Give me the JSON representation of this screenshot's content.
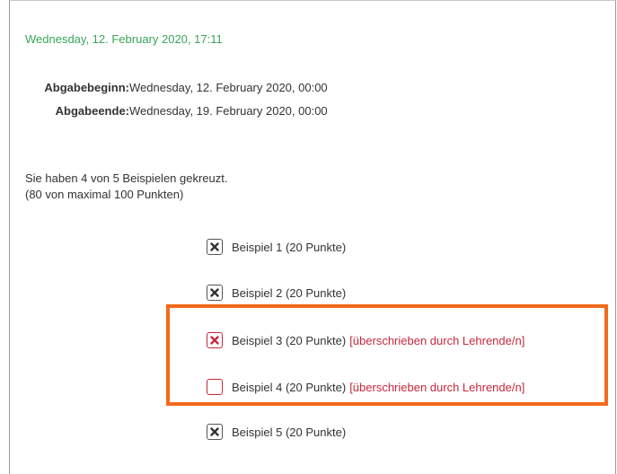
{
  "current_time": "Wednesday, 12. February 2020, 17:11",
  "submission": {
    "begin_label": "Abgabebeginn:",
    "begin_value": "Wednesday, 12. February 2020, 00:00",
    "end_label": "Abgabeende:",
    "end_value": "Wednesday, 19. February 2020, 00:00"
  },
  "summary": {
    "line1": "Sie haben 4 von 5 Beispielen gekreuzt.",
    "line2": "(80 von maximal 100 Punkten)"
  },
  "examples": [
    {
      "label": "Beispiel 1 (20 Punkte)",
      "checked": true,
      "override_text": ""
    },
    {
      "label": "Beispiel 2 (20 Punkte)",
      "checked": true,
      "override_text": ""
    },
    {
      "label": "Beispiel 3 (20 Punkte)",
      "checked": true,
      "override_text": "[überschrieben durch Lehrende/n]"
    },
    {
      "label": "Beispiel 4 (20 Punkte)",
      "checked": false,
      "override_text": "[überschrieben durch Lehrende/n]"
    },
    {
      "label": "Beispiel 5 (20 Punkte)",
      "checked": true,
      "override_text": ""
    }
  ],
  "colors": {
    "timestamp": "#3aa45a",
    "override": "#c8283c",
    "highlight": "#f26a1b"
  },
  "icons": {
    "checked": "x-mark-icon",
    "unchecked": "empty-checkbox"
  }
}
